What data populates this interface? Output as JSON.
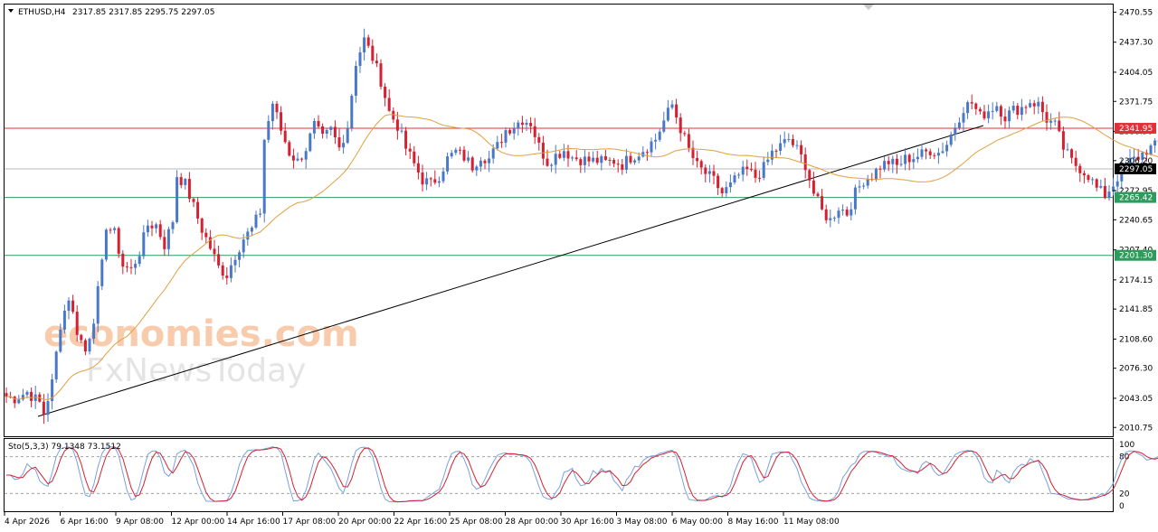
{
  "chart_data": [
    {
      "type": "candlestick",
      "symbol": "ETHUSD,H4",
      "header_values": "2317.85 2317.85 2295.75 2297.05",
      "ylim": [
        2001,
        2479
      ],
      "y_ticks": [
        "2470.55",
        "2437.30",
        "2404.05",
        "2371.75",
        "2338.50",
        "2306.20",
        "2272.95",
        "2240.65",
        "2207.40",
        "2174.15",
        "2141.85",
        "2108.60",
        "2076.30",
        "2043.05",
        "2010.75"
      ],
      "x_ticks": [
        "4 Apr 2026",
        "6 Apr 16:00",
        "9 Apr 08:00",
        "12 Apr 00:00",
        "14 Apr 16:00",
        "17 Apr 08:00",
        "20 Apr 00:00",
        "22 Apr 16:00",
        "25 Apr 08:00",
        "28 Apr 00:00",
        "30 Apr 16:00",
        "3 May 08:00",
        "6 May 00:00",
        "8 May 16:00",
        "11 May 08:00"
      ],
      "current_price": {
        "label": "2297.05",
        "value": 2297.05
      },
      "horizontal_levels": [
        {
          "label": "2341.95",
          "value": 2341.95,
          "color": "#e0303a"
        },
        {
          "label": "2265.42",
          "value": 2265.42,
          "color": "#2e9a5c"
        },
        {
          "label": "2201.30",
          "value": 2201.3,
          "color": "#2e9a5c"
        }
      ],
      "trendline": {
        "from": [
          0,
          2023
        ],
        "to": [
          150,
          2345
        ]
      },
      "moving_average_color": "#e0a040",
      "up_color": "#4a78c8",
      "down_color": "#d42030",
      "watermark": [
        "economies.com",
        "FxNewsToday"
      ],
      "close_path": [
        [
          0,
          2045
        ],
        [
          2,
          2043
        ],
        [
          5,
          2050
        ],
        [
          8,
          2038
        ],
        [
          9,
          2026
        ],
        [
          11,
          2060
        ],
        [
          13,
          2125
        ],
        [
          15,
          2155
        ],
        [
          17,
          2118
        ],
        [
          19,
          2095
        ],
        [
          21,
          2132
        ],
        [
          23,
          2190
        ],
        [
          24,
          2235
        ],
        [
          26,
          2225
        ],
        [
          28,
          2190
        ],
        [
          30,
          2185
        ],
        [
          32,
          2205
        ],
        [
          34,
          2235
        ],
        [
          36,
          2235
        ],
        [
          38,
          2213
        ],
        [
          40,
          2240
        ],
        [
          41,
          2290
        ],
        [
          43,
          2280
        ],
        [
          45,
          2255
        ],
        [
          47,
          2230
        ],
        [
          49,
          2210
        ],
        [
          51,
          2188
        ],
        [
          53,
          2180
        ],
        [
          55,
          2202
        ],
        [
          57,
          2220
        ],
        [
          59,
          2230
        ],
        [
          61,
          2250
        ],
        [
          62,
          2330
        ],
        [
          64,
          2370
        ],
        [
          66,
          2340
        ],
        [
          68,
          2315
        ],
        [
          70,
          2305
        ],
        [
          72,
          2320
        ],
        [
          74,
          2345
        ],
        [
          76,
          2330
        ],
        [
          78,
          2340
        ],
        [
          80,
          2320
        ],
        [
          82,
          2345
        ],
        [
          84,
          2415
        ],
        [
          86,
          2440
        ],
        [
          88,
          2420
        ],
        [
          90,
          2395
        ],
        [
          92,
          2360
        ],
        [
          94,
          2345
        ],
        [
          96,
          2320
        ],
        [
          98,
          2302
        ],
        [
          100,
          2285
        ],
        [
          102,
          2280
        ],
        [
          104,
          2290
        ],
        [
          106,
          2308
        ],
        [
          108,
          2316
        ],
        [
          110,
          2310
        ],
        [
          112,
          2300
        ],
        [
          114,
          2312
        ],
        [
          116,
          2308
        ],
        [
          118,
          2322
        ],
        [
          120,
          2340
        ],
        [
          122,
          2345
        ],
        [
          124,
          2352
        ],
        [
          126,
          2348
        ],
        [
          128,
          2322
        ],
        [
          130,
          2305
        ],
        [
          132,
          2312
        ],
        [
          134,
          2318
        ],
        [
          136,
          2310
        ],
        [
          138,
          2308
        ],
        [
          140,
          2306
        ],
        [
          142,
          2306
        ],
        [
          144,
          2304
        ],
        [
          146,
          2306
        ],
        [
          148,
          2302
        ],
        [
          150,
          2310
        ],
        [
          152,
          2315
        ],
        [
          154,
          2322
        ],
        [
          156,
          2330
        ],
        [
          158,
          2350
        ],
        [
          160,
          2368
        ],
        [
          162,
          2342
        ],
        [
          164,
          2318
        ],
        [
          166,
          2300
        ],
        [
          168,
          2292
        ],
        [
          170,
          2284
        ],
        [
          172,
          2270
        ],
        [
          174,
          2278
        ],
        [
          176,
          2290
        ],
        [
          178,
          2295
        ],
        [
          180,
          2288
        ],
        [
          182,
          2298
        ],
        [
          184,
          2315
        ],
        [
          186,
          2322
        ],
        [
          188,
          2330
        ],
        [
          190,
          2318
        ],
        [
          192,
          2302
        ],
        [
          194,
          2270
        ],
        [
          196,
          2250
        ],
        [
          198,
          2240
        ],
        [
          200,
          2255
        ],
        [
          202,
          2248
        ],
        [
          204,
          2270
        ],
        [
          206,
          2285
        ],
        [
          208,
          2290
        ],
        [
          210,
          2300
        ],
        [
          212,
          2305
        ],
        [
          214,
          2300
        ],
        [
          216,
          2308
        ],
        [
          218,
          2310
        ],
        [
          220,
          2313
        ],
        [
          222,
          2318
        ],
        [
          224,
          2315
        ],
        [
          226,
          2325
        ],
        [
          228,
          2345
        ],
        [
          230,
          2365
        ],
        [
          232,
          2370
        ],
        [
          234,
          2355
        ],
        [
          236,
          2362
        ],
        [
          238,
          2368
        ],
        [
          240,
          2355
        ],
        [
          242,
          2362
        ],
        [
          244,
          2365
        ],
        [
          246,
          2372
        ],
        [
          248,
          2368
        ],
        [
          250,
          2352
        ],
        [
          252,
          2345
        ],
        [
          254,
          2320
        ],
        [
          256,
          2305
        ],
        [
          258,
          2298
        ],
        [
          260,
          2290
        ],
        [
          262,
          2275
        ],
        [
          264,
          2268
        ],
        [
          266,
          2280
        ],
        [
          268,
          2296
        ],
        [
          270,
          2305
        ],
        [
          272,
          2310
        ],
        [
          274,
          2318
        ],
        [
          276,
          2322
        ],
        [
          278,
          2328
        ],
        [
          280,
          2330
        ],
        [
          282,
          2328
        ],
        [
          284,
          2328
        ],
        [
          286,
          2322
        ],
        [
          288,
          2330
        ],
        [
          290,
          2350
        ],
        [
          292,
          2358
        ],
        [
          294,
          2344
        ],
        [
          296,
          2330
        ],
        [
          298,
          2315
        ],
        [
          300,
          2305
        ],
        [
          302,
          2300
        ],
        [
          304,
          2292
        ],
        [
          306,
          2275
        ],
        [
          308,
          2265
        ],
        [
          310,
          2275
        ],
        [
          312,
          2285
        ],
        [
          314,
          2298
        ],
        [
          316,
          2312
        ],
        [
          318,
          2305
        ],
        [
          319,
          2297
        ]
      ]
    },
    {
      "type": "line",
      "label": "Sto(5,3,3) 79.1348 73.1512",
      "ylim": [
        0,
        100
      ],
      "y_ticks": [
        "100",
        "80",
        "20",
        "0"
      ],
      "levels": [
        80,
        20
      ],
      "series_colors": [
        "#7aa0e0",
        "#d42030"
      ]
    }
  ]
}
